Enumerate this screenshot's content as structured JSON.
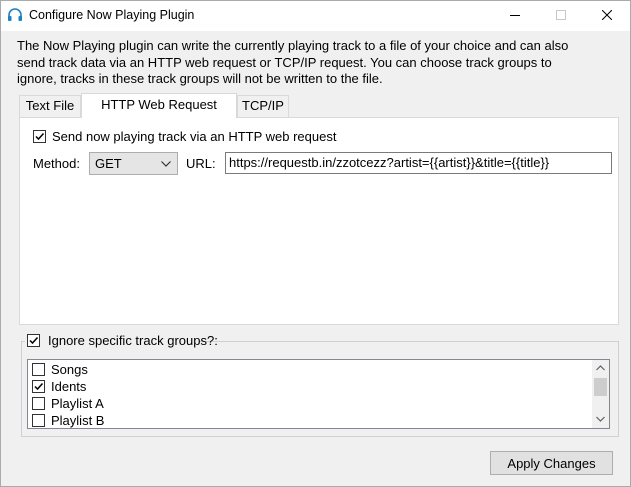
{
  "window": {
    "title": "Configure Now Playing Plugin"
  },
  "description": [
    "The Now Playing plugin can write the currently playing track to a file of your choice and can also",
    "send track data via an HTTP web request or TCP/IP request. You can choose track groups to",
    "ignore, tracks in these track groups will not be written to the file."
  ],
  "tabs": [
    {
      "label": "Text File",
      "active": false
    },
    {
      "label": "HTTP Web Request",
      "active": true
    },
    {
      "label": "TCP/IP",
      "active": false
    }
  ],
  "http": {
    "send_label": "Send now playing track via an HTTP web request",
    "send_checked": true,
    "method_label": "Method:",
    "method_value": "GET",
    "url_label": "URL:",
    "url_value": "https://requestb.in/zzotcezz?artist={{artist}}&title={{title}}"
  },
  "ignore": {
    "label": "Ignore specific track groups?:",
    "checked": true,
    "groups": [
      {
        "label": "Songs",
        "checked": false
      },
      {
        "label": "Idents",
        "checked": true
      },
      {
        "label": "Playlist A",
        "checked": false
      },
      {
        "label": "Playlist B",
        "checked": false
      }
    ]
  },
  "apply_label": "Apply Changes"
}
